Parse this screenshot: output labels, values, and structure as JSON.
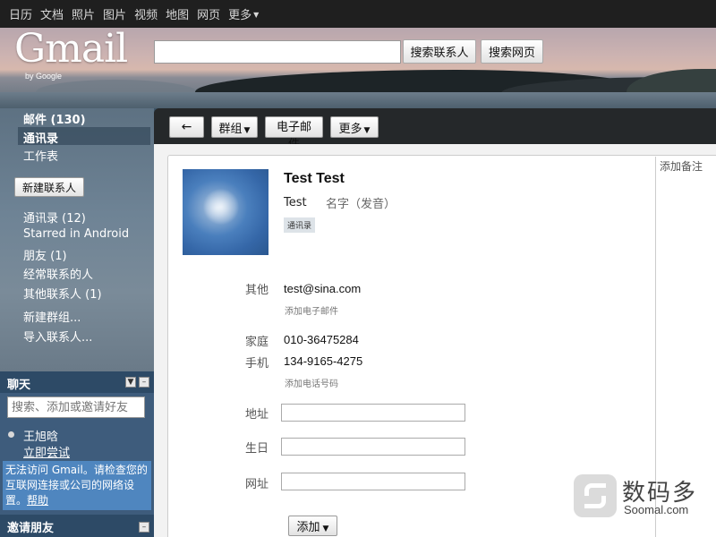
{
  "topbar": {
    "items": [
      "日历",
      "文档",
      "照片",
      "图片",
      "视频",
      "地图",
      "网页",
      "更多"
    ]
  },
  "header": {
    "logo_text": "Gmail",
    "logo_sub": "by Google",
    "search_value": "",
    "search_contacts_label": "搜索联系人",
    "search_web_label": "搜索网页"
  },
  "sidebar": {
    "mail": "邮件 (130)",
    "contacts": "通讯录",
    "tasks": "工作表",
    "new_contact": "新建联系人",
    "groups": [
      "通讯录 (12)",
      "Starred in Android",
      "朋友 (1)",
      "经常联系的人",
      "其他联系人 (1)"
    ],
    "new_group": "新建群组...",
    "import_contacts": "导入联系人..."
  },
  "chat": {
    "title": "聊天",
    "search_placeholder": "搜索、添加或邀请好友",
    "user": "王旭晗",
    "try_now": "立即尝试",
    "error_text": "无法访问 Gmail。请检查您的互联网连接或公司的网络设置。",
    "help": "帮助"
  },
  "invite": {
    "title": "邀请朋友"
  },
  "toolbar": {
    "back_icon": "←",
    "groups": "群组",
    "email": "电子邮件",
    "more": "更多"
  },
  "contact": {
    "full_name": "Test Test",
    "first_name": "Test",
    "phonetic_label": "名字（发音）",
    "group_badge": "通讯录",
    "email_label": "其他",
    "email": "test@sina.com",
    "add_email": "添加电子邮件",
    "home_label": "家庭",
    "home_phone": "010-36475284",
    "mobile_label": "手机",
    "mobile_phone": "134-9165-4275",
    "add_phone": "添加电话号码",
    "address_label": "地址",
    "birthday_label": "生日",
    "website_label": "网址",
    "add_button": "添加",
    "notes_placeholder": "添加备注"
  },
  "watermark": {
    "cn": "数码多",
    "en": "Soomal.com"
  }
}
